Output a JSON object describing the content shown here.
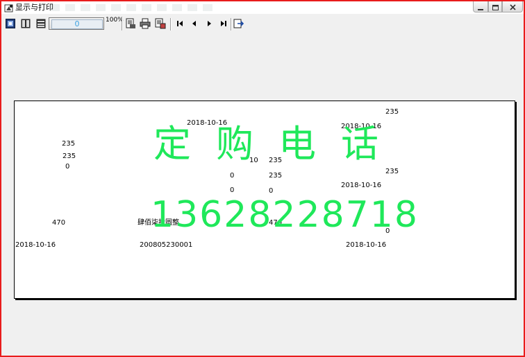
{
  "window": {
    "title": "显示与打印",
    "accent_border_color": "#e81c1c"
  },
  "toolbar": {
    "buttons": [
      {
        "name": "fit-page-icon"
      },
      {
        "name": "fit-width-icon"
      },
      {
        "name": "actual-size-icon"
      }
    ],
    "zoom": {
      "value": "0",
      "label": "100%"
    },
    "print_buttons": [
      {
        "name": "print-setup-icon"
      },
      {
        "name": "print-icon"
      },
      {
        "name": "print-preview-icon"
      }
    ],
    "nav_buttons": [
      {
        "name": "first-page-icon"
      },
      {
        "name": "prev-page-icon"
      },
      {
        "name": "next-page-icon"
      },
      {
        "name": "last-page-icon"
      }
    ],
    "exit_button": {
      "name": "exit-icon"
    }
  },
  "preview": {
    "fields": [
      {
        "text": "235"
      },
      {
        "text": "2018-10-16"
      },
      {
        "text": "2018-10-16"
      },
      {
        "text": "235"
      },
      {
        "text": "235"
      },
      {
        "text": "10"
      },
      {
        "text": "235"
      },
      {
        "text": "0"
      },
      {
        "text": "235"
      },
      {
        "text": "0"
      },
      {
        "text": "235"
      },
      {
        "text": "2018-10-16"
      },
      {
        "text": "0"
      },
      {
        "text": "0"
      },
      {
        "text": "470"
      },
      {
        "text": "肆佰柒拾圆整"
      },
      {
        "text": "470"
      },
      {
        "text": "0"
      },
      {
        "text": "2018-10-16"
      },
      {
        "text": "200805230001"
      },
      {
        "text": "2018-10-16"
      }
    ],
    "watermark": {
      "line1": "定购电话",
      "line2": "13628228718",
      "color": "#1fe85a"
    }
  }
}
